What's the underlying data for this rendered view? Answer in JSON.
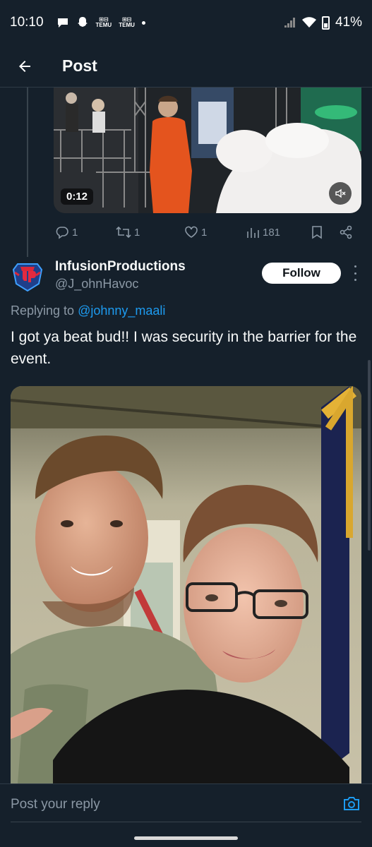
{
  "status_bar": {
    "time": "10:10",
    "notif_app_1": "TEMU",
    "notif_app_2": "TEMU",
    "battery": "41%"
  },
  "header": {
    "back_icon": "arrow-left-icon",
    "title": "Post"
  },
  "video": {
    "duration": "0:12",
    "mute_icon": "speaker-muted-icon"
  },
  "actions": {
    "replies": "1",
    "reposts": "1",
    "likes": "1",
    "views": "181"
  },
  "reply_post": {
    "display_name": "InfusionProductions",
    "handle": "@J_ohnHavoc",
    "follow_label": "Follow",
    "replying_prefix": "Replying to ",
    "replying_to": "@johnny_maali",
    "text": "I got ya beat bud!! I was security in the barrier for the event."
  },
  "reply_bar": {
    "placeholder": "Post your reply",
    "camera_icon": "camera-icon"
  },
  "colors": {
    "background": "#15202b",
    "accent": "#1d9bf0",
    "muted": "#8b98a5"
  }
}
